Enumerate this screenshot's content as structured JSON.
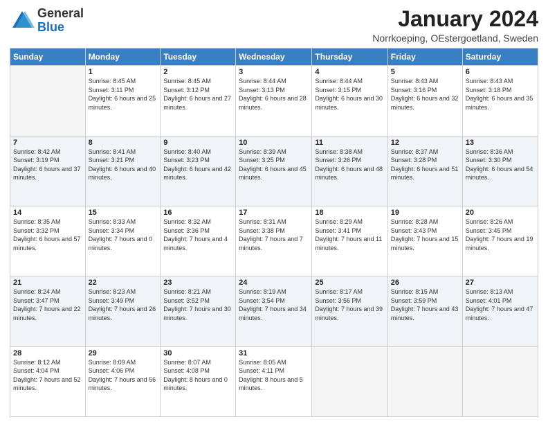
{
  "header": {
    "logo_general": "General",
    "logo_blue": "Blue",
    "month_title": "January 2024",
    "location": "Norrkoeping, OEstergoetland, Sweden"
  },
  "weekdays": [
    "Sunday",
    "Monday",
    "Tuesday",
    "Wednesday",
    "Thursday",
    "Friday",
    "Saturday"
  ],
  "weeks": [
    [
      {
        "day": "",
        "sunrise": "",
        "sunset": "",
        "daylight": ""
      },
      {
        "day": "1",
        "sunrise": "Sunrise: 8:45 AM",
        "sunset": "Sunset: 3:11 PM",
        "daylight": "Daylight: 6 hours and 25 minutes."
      },
      {
        "day": "2",
        "sunrise": "Sunrise: 8:45 AM",
        "sunset": "Sunset: 3:12 PM",
        "daylight": "Daylight: 6 hours and 27 minutes."
      },
      {
        "day": "3",
        "sunrise": "Sunrise: 8:44 AM",
        "sunset": "Sunset: 3:13 PM",
        "daylight": "Daylight: 6 hours and 28 minutes."
      },
      {
        "day": "4",
        "sunrise": "Sunrise: 8:44 AM",
        "sunset": "Sunset: 3:15 PM",
        "daylight": "Daylight: 6 hours and 30 minutes."
      },
      {
        "day": "5",
        "sunrise": "Sunrise: 8:43 AM",
        "sunset": "Sunset: 3:16 PM",
        "daylight": "Daylight: 6 hours and 32 minutes."
      },
      {
        "day": "6",
        "sunrise": "Sunrise: 8:43 AM",
        "sunset": "Sunset: 3:18 PM",
        "daylight": "Daylight: 6 hours and 35 minutes."
      }
    ],
    [
      {
        "day": "7",
        "sunrise": "Sunrise: 8:42 AM",
        "sunset": "Sunset: 3:19 PM",
        "daylight": "Daylight: 6 hours and 37 minutes."
      },
      {
        "day": "8",
        "sunrise": "Sunrise: 8:41 AM",
        "sunset": "Sunset: 3:21 PM",
        "daylight": "Daylight: 6 hours and 40 minutes."
      },
      {
        "day": "9",
        "sunrise": "Sunrise: 8:40 AM",
        "sunset": "Sunset: 3:23 PM",
        "daylight": "Daylight: 6 hours and 42 minutes."
      },
      {
        "day": "10",
        "sunrise": "Sunrise: 8:39 AM",
        "sunset": "Sunset: 3:25 PM",
        "daylight": "Daylight: 6 hours and 45 minutes."
      },
      {
        "day": "11",
        "sunrise": "Sunrise: 8:38 AM",
        "sunset": "Sunset: 3:26 PM",
        "daylight": "Daylight: 6 hours and 48 minutes."
      },
      {
        "day": "12",
        "sunrise": "Sunrise: 8:37 AM",
        "sunset": "Sunset: 3:28 PM",
        "daylight": "Daylight: 6 hours and 51 minutes."
      },
      {
        "day": "13",
        "sunrise": "Sunrise: 8:36 AM",
        "sunset": "Sunset: 3:30 PM",
        "daylight": "Daylight: 6 hours and 54 minutes."
      }
    ],
    [
      {
        "day": "14",
        "sunrise": "Sunrise: 8:35 AM",
        "sunset": "Sunset: 3:32 PM",
        "daylight": "Daylight: 6 hours and 57 minutes."
      },
      {
        "day": "15",
        "sunrise": "Sunrise: 8:33 AM",
        "sunset": "Sunset: 3:34 PM",
        "daylight": "Daylight: 7 hours and 0 minutes."
      },
      {
        "day": "16",
        "sunrise": "Sunrise: 8:32 AM",
        "sunset": "Sunset: 3:36 PM",
        "daylight": "Daylight: 7 hours and 4 minutes."
      },
      {
        "day": "17",
        "sunrise": "Sunrise: 8:31 AM",
        "sunset": "Sunset: 3:38 PM",
        "daylight": "Daylight: 7 hours and 7 minutes."
      },
      {
        "day": "18",
        "sunrise": "Sunrise: 8:29 AM",
        "sunset": "Sunset: 3:41 PM",
        "daylight": "Daylight: 7 hours and 11 minutes."
      },
      {
        "day": "19",
        "sunrise": "Sunrise: 8:28 AM",
        "sunset": "Sunset: 3:43 PM",
        "daylight": "Daylight: 7 hours and 15 minutes."
      },
      {
        "day": "20",
        "sunrise": "Sunrise: 8:26 AM",
        "sunset": "Sunset: 3:45 PM",
        "daylight": "Daylight: 7 hours and 19 minutes."
      }
    ],
    [
      {
        "day": "21",
        "sunrise": "Sunrise: 8:24 AM",
        "sunset": "Sunset: 3:47 PM",
        "daylight": "Daylight: 7 hours and 22 minutes."
      },
      {
        "day": "22",
        "sunrise": "Sunrise: 8:23 AM",
        "sunset": "Sunset: 3:49 PM",
        "daylight": "Daylight: 7 hours and 26 minutes."
      },
      {
        "day": "23",
        "sunrise": "Sunrise: 8:21 AM",
        "sunset": "Sunset: 3:52 PM",
        "daylight": "Daylight: 7 hours and 30 minutes."
      },
      {
        "day": "24",
        "sunrise": "Sunrise: 8:19 AM",
        "sunset": "Sunset: 3:54 PM",
        "daylight": "Daylight: 7 hours and 34 minutes."
      },
      {
        "day": "25",
        "sunrise": "Sunrise: 8:17 AM",
        "sunset": "Sunset: 3:56 PM",
        "daylight": "Daylight: 7 hours and 39 minutes."
      },
      {
        "day": "26",
        "sunrise": "Sunrise: 8:15 AM",
        "sunset": "Sunset: 3:59 PM",
        "daylight": "Daylight: 7 hours and 43 minutes."
      },
      {
        "day": "27",
        "sunrise": "Sunrise: 8:13 AM",
        "sunset": "Sunset: 4:01 PM",
        "daylight": "Daylight: 7 hours and 47 minutes."
      }
    ],
    [
      {
        "day": "28",
        "sunrise": "Sunrise: 8:12 AM",
        "sunset": "Sunset: 4:04 PM",
        "daylight": "Daylight: 7 hours and 52 minutes."
      },
      {
        "day": "29",
        "sunrise": "Sunrise: 8:09 AM",
        "sunset": "Sunset: 4:06 PM",
        "daylight": "Daylight: 7 hours and 56 minutes."
      },
      {
        "day": "30",
        "sunrise": "Sunrise: 8:07 AM",
        "sunset": "Sunset: 4:08 PM",
        "daylight": "Daylight: 8 hours and 0 minutes."
      },
      {
        "day": "31",
        "sunrise": "Sunrise: 8:05 AM",
        "sunset": "Sunset: 4:11 PM",
        "daylight": "Daylight: 8 hours and 5 minutes."
      },
      {
        "day": "",
        "sunrise": "",
        "sunset": "",
        "daylight": ""
      },
      {
        "day": "",
        "sunrise": "",
        "sunset": "",
        "daylight": ""
      },
      {
        "day": "",
        "sunrise": "",
        "sunset": "",
        "daylight": ""
      }
    ]
  ]
}
